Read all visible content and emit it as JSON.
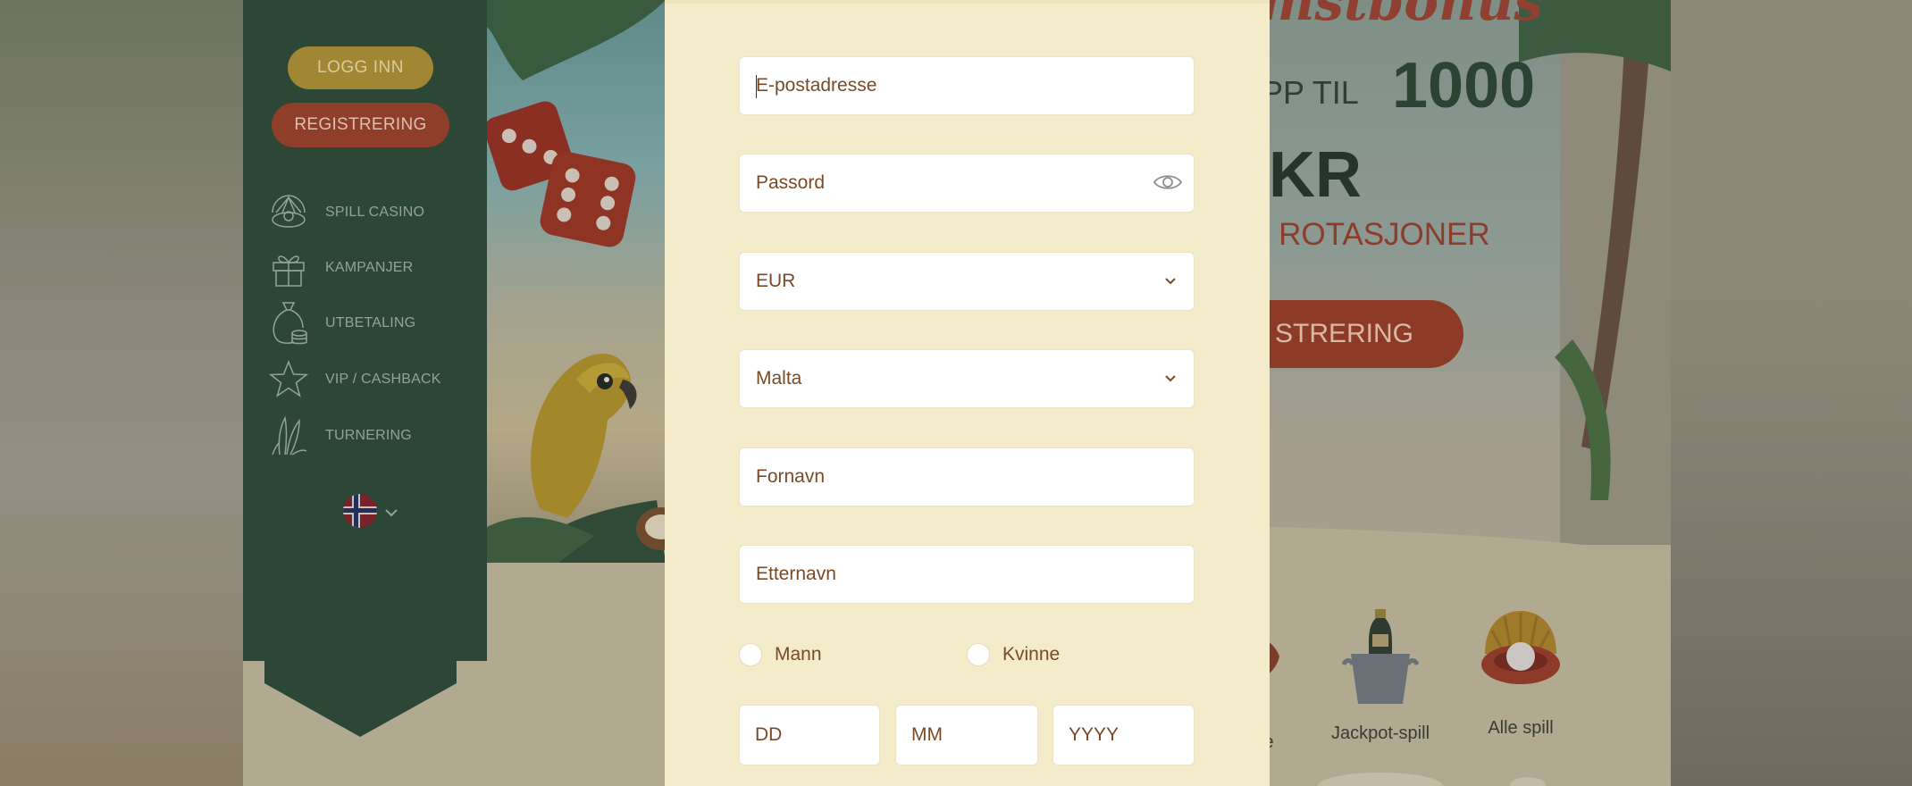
{
  "sidebar": {
    "login_label": "LOGG INN",
    "register_label": "REGISTRERING",
    "items": [
      {
        "label": "SPILL CASINO",
        "icon": "pearl-shell-icon"
      },
      {
        "label": "KAMPANJER",
        "icon": "gift-icon"
      },
      {
        "label": "UTBETALING",
        "icon": "money-bag-icon"
      },
      {
        "label": "VIP / CASHBACK",
        "icon": "star-icon"
      },
      {
        "label": "TURNERING",
        "icon": "palm-leaf-icon"
      }
    ],
    "language_flag": "norway-flag-icon"
  },
  "promo": {
    "headline_fragment": "mstbonus",
    "up_to_prefix": "OPP TIL",
    "amount": "1000",
    "currency": "KR",
    "spins_fragment": "S ROTASJONER",
    "cta_fragment": "STRERING"
  },
  "categories": [
    {
      "label": "e"
    },
    {
      "label": "Jackpot-spill"
    },
    {
      "label": "Alle spill"
    }
  ],
  "form": {
    "email_placeholder": "E-postadresse",
    "password_placeholder": "Passord",
    "currency_value": "EUR",
    "country_value": "Malta",
    "first_name_placeholder": "Fornavn",
    "last_name_placeholder": "Etternavn",
    "gender_male": "Mann",
    "gender_female": "Kvinne",
    "day_placeholder": "DD",
    "month_placeholder": "MM",
    "year_placeholder": "YYYY"
  },
  "colors": {
    "nav_green": "#2c4735",
    "login_gold": "#a18633",
    "register_red": "#8f3e29",
    "modal_bg": "#f4ebcb",
    "field_text": "#7a4a27"
  }
}
